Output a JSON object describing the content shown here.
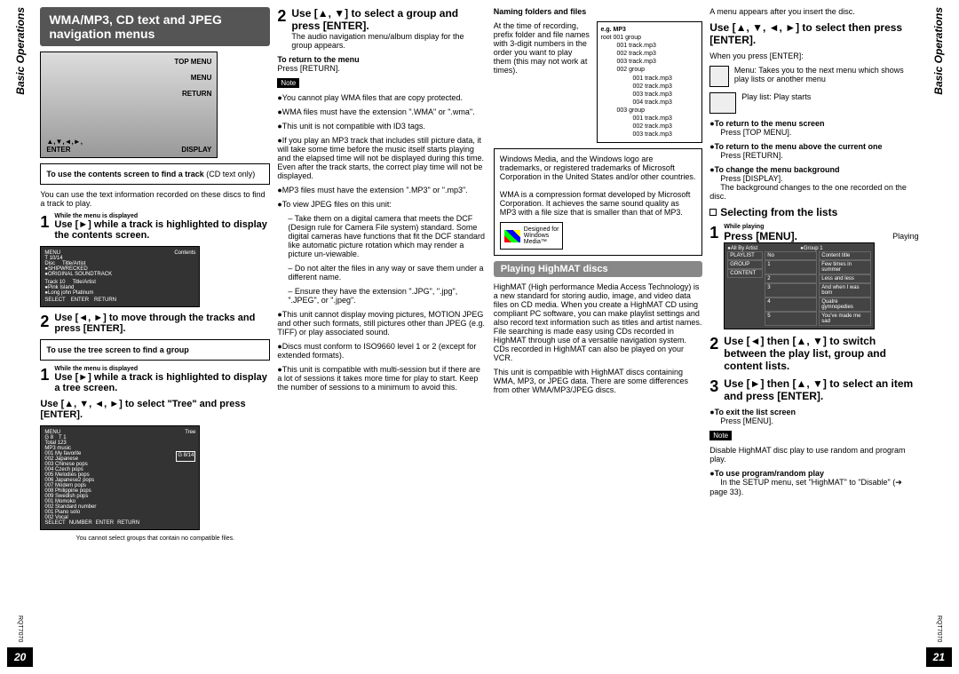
{
  "header": {
    "title": "WMA/MP3, CD text and JPEG navigation menus"
  },
  "device": {
    "top_menu": "TOP MENU",
    "menu": "MENU",
    "return": "RETURN",
    "cursor": "▲,▼,◄,►,\nENTER",
    "display": "DISPLAY"
  },
  "col1": {
    "box_title1": "To use the contents screen to find a track",
    "box_title1_note": "(CD text only)",
    "intro": "You can use the text information recorded on these discs to find a track to play.",
    "step1_while": "While the menu is displayed",
    "step1": "Use [►] while a track is highlighted to display the contents screen.",
    "contents_screen": {
      "header_menu": "MENU",
      "header_contents": "Contents",
      "t": "T 10/14",
      "disc": "Disc",
      "title_artist": "Title/Artist",
      "rows1": [
        "●SHIPWRECKED",
        "●ORIGINAL SOUNDTRACK"
      ],
      "track": "Track 10",
      "title_artist2": "Title/Artist",
      "rows2": [
        "●Pink Island",
        "●Long john Platinum"
      ],
      "select": "SELECT",
      "enter": "ENTER",
      "return": "RETURN"
    },
    "step2": "Use [◄, ►] to move through the tracks and press [ENTER].",
    "box_title2": "To use the tree screen to find a group",
    "step1b_while": "While the menu is displayed",
    "step1b": "Use [►] while a track is highlighted to display a tree screen.",
    "step_tree": "Use [▲, ▼, ◄, ►] to select \"Tree\" and press [ENTER].",
    "tree_screen": {
      "menu": "MENU",
      "tree": "Tree",
      "g": "G  8",
      "t": "T 1",
      "total": "Total 123",
      "mp3": "MP3 music",
      "items": [
        "001 My favorite",
        "002 Japanese",
        "003 Chinese pops",
        "004 Czech pops",
        "005 Melodies pops",
        "006 Japanese2 pops",
        "007 Modern pops",
        "008 Philippine pops",
        "009 Swedish pops",
        "001 Momoko",
        "002 Standard number",
        "001 Piano solo",
        "002 Vocal"
      ],
      "sub_g": "G 8/14",
      "select": "SELECT",
      "number": "NUMBER",
      "enter": "ENTER",
      "return": "RETURN"
    },
    "tree_note": "You cannot select groups that contain no compatible files."
  },
  "col2": {
    "step2_title": "Use [▲, ▼] to select a group and press [ENTER].",
    "step2_body": "The audio navigation menu/album display for the group appears.",
    "return_h": "To return to the menu",
    "return_b": "Press [RETURN].",
    "note_label": "Note",
    "notes": [
      "●You cannot play WMA files that are copy protected.",
      "●WMA files must have the extension \".WMA\" or \".wma\".",
      "●This unit is not compatible with ID3 tags.",
      "●If you play an MP3 track that includes still picture data, it will take some time before the music itself starts playing and the elapsed time will not be displayed during this time. Even after the track starts, the correct play time will not be displayed.",
      "●MP3 files must have the extension \".MP3\" or \".mp3\".",
      "●To view JPEG files on this unit:"
    ],
    "jpeg_sub": [
      "– Take them on a digital camera that meets the DCF (Design rule for Camera File system) standard. Some digital cameras have functions that fit the DCF standard like automatic picture rotation which may render a picture un-viewable.",
      "– Do not alter the files in any way or save them under a different name.",
      "– Ensure they have the extension \".JPG\", \".jpg\", \".JPEG\", or \".jpeg\"."
    ],
    "notes2": [
      "●This unit cannot display moving pictures, MOTION JPEG and other such formats, still pictures other than JPEG (e.g. TIFF) or play associated sound.",
      "●Discs must conform to ISO9660 level 1 or 2 (except for extended formats).",
      "●This unit is compatible with multi-session but if there are a lot of sessions it takes more time for play to start. Keep the number of sessions to a minimum to avoid this."
    ]
  },
  "col3": {
    "naming": "Naming folders and files",
    "naming_body": "At the time of recording, prefix folder and file names with 3-digit numbers in the order you want to play them (this may not work at times).",
    "eg": "e.g. MP3",
    "tree": {
      "root": "root",
      "g1": "001 group",
      "f1": [
        "001 track.mp3",
        "002 track.mp3",
        "003 track.mp3"
      ],
      "g2": "002 group",
      "f2": [
        "001 track.mp3",
        "002 track.mp3",
        "003 track.mp3",
        "004 track.mp3"
      ],
      "g3": "003 group",
      "f3": [
        "001 track.mp3",
        "002 track.mp3",
        "003 track.mp3"
      ]
    },
    "box_wm1": "Windows Media, and the Windows logo are trademarks, or registered trademarks of Microsoft Corporation in the United States and/or other countries.",
    "box_wm2": "WMA is a compression format developed by Microsoft Corporation. It achieves the same sound quality as MP3 with a file size that is smaller than that of MP3.",
    "wm_badge": "Designed for\nWindows\nMedia™",
    "highmat_title": "Playing HighMAT discs",
    "highmat_body": "HighMAT (High performance Media Access Technology) is a new standard for storing audio, image, and video data files on CD media. When you create a HighMAT CD using compliant PC software, you can make playlist settings and also record text information such as titles and artist names. File searching is made easy using CDs recorded in HighMAT through use of a versatile navigation system. CDs recorded in HighMAT can also be played on your VCR.",
    "highmat_compat": "This unit is compatible with HighMAT discs containing WMA, MP3, or JPEG data. There are some differences from other WMA/MP3/JPEG discs."
  },
  "col4": {
    "intro": "A menu appears after you insert the disc.",
    "step_sel": "Use [▲, ▼, ◄, ►] to select then press [ENTER].",
    "when_enter": "When you press [ENTER]:",
    "menu_label": "Menu:",
    "menu_desc": "Takes you to the next menu which shows play lists or another menu",
    "playlist_label": "Play list:",
    "playlist_desc": "Play starts",
    "bullets": [
      {
        "h": "●To return to the menu screen",
        "b": "Press [TOP MENU]."
      },
      {
        "h": "●To return to the menu above the current one",
        "b": "Press [RETURN]."
      },
      {
        "h": "●To change the menu background",
        "b": "Press [DISPLAY].",
        "b2": "The background changes to the one recorded on the disc."
      }
    ],
    "selecting": "Selecting from the lists",
    "step1_while": "While playing",
    "step1": "Press [MENU].",
    "playing_label": "Playing",
    "menu_screen": {
      "tabs": [
        "●All By Artist",
        "●Group 1"
      ],
      "cols": [
        "No",
        "Content title"
      ],
      "rows": [
        [
          "1",
          "Few times in summer"
        ],
        [
          "2",
          "Less and less"
        ],
        [
          "3",
          "And when I was born"
        ],
        [
          "4",
          "Quatre gymnopedies"
        ],
        [
          "5",
          "You've made me sad"
        ]
      ],
      "side": [
        "PLAYLIST",
        "GROUP",
        "CONTENT"
      ]
    },
    "step2": "Use [◄] then [▲, ▼] to switch between the play list, group and content lists.",
    "step3": "Use [►] then [▲, ▼] to select an item and press [ENTER].",
    "exit_h": "●To exit the list screen",
    "exit_b": "Press [MENU].",
    "note_label": "Note",
    "note1": "Disable HighMAT disc play to use random and program play.",
    "prog_h": "●To use program/random play",
    "prog_b": "In the SETUP menu, set \"HighMAT\" to \"Disable\" (➔ page 33)."
  },
  "side_left": "Basic Operations",
  "side_right": "Basic Operations",
  "code": "RQT7070",
  "page_left": "20",
  "page_right": "21"
}
